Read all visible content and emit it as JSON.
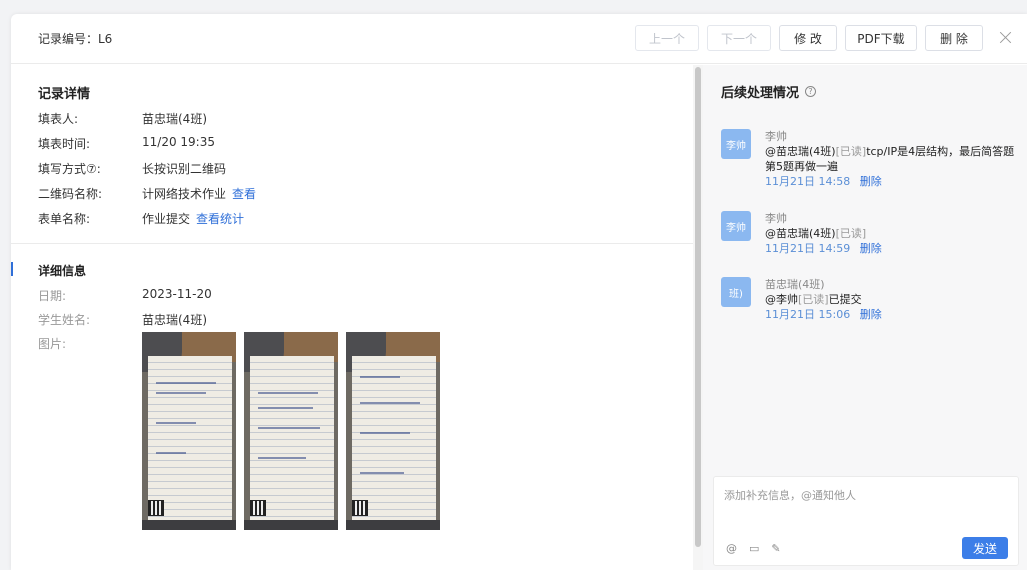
{
  "header": {
    "record_id": "记录编号：L6",
    "prev_label": "上一个",
    "next_label": "下一个",
    "edit_label": "修 改",
    "pdf_label": "PDF下载",
    "delete_label": "删 除"
  },
  "record": {
    "title": "记录详情",
    "fields": [
      {
        "label": "填表人:",
        "value": "苗忠瑞(4班)"
      },
      {
        "label": "填表时间:",
        "value": "11/20 19:35"
      },
      {
        "label": "填写方式⑦:",
        "value": "长按识别二维码"
      },
      {
        "label": "二维码名称:",
        "value": "计网络技术作业",
        "link": "查看"
      },
      {
        "label": "表单名称:",
        "value": "作业提交",
        "link": "查看统计"
      }
    ]
  },
  "detail": {
    "title": "详细信息",
    "fields": [
      {
        "label": "日期:",
        "value": "2023-11-20"
      },
      {
        "label": "学生姓名:",
        "value": "苗忠瑞(4班)"
      },
      {
        "label": "图片:",
        "value": ""
      }
    ]
  },
  "followup": {
    "title": "后续处理情况",
    "help_icon": "?",
    "comments": [
      {
        "avatar": "李帅",
        "name": "李帅",
        "mention": "@苗忠瑞(4班)",
        "read": "[已读]",
        "text": "tcp/IP是4层结构，最后简答题第5题再做一遍",
        "time": "11月21日 14:58",
        "delete": "删除"
      },
      {
        "avatar": "李帅",
        "name": "李帅",
        "mention": "@苗忠瑞(4班)",
        "read": "[已读]",
        "text": "",
        "time": "11月21日 14:59",
        "delete": "删除"
      },
      {
        "avatar": "班)",
        "name": "苗忠瑞(4班)",
        "mention": "@李帅",
        "read": "[已读]",
        "text": "已提交",
        "time": "11月21日 15:06",
        "delete": "删除"
      }
    ]
  },
  "composer": {
    "placeholder": "添加补充信息，@通知他人",
    "at_icon": "@",
    "image_icon": "▭",
    "pen_icon": "✎",
    "send_label": "发送"
  }
}
